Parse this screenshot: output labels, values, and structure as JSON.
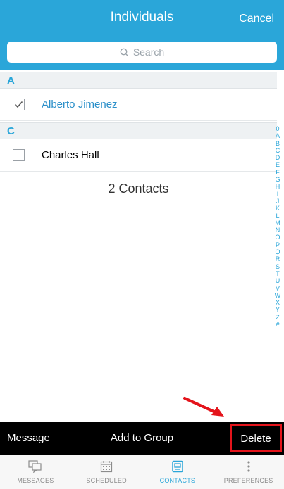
{
  "header": {
    "title": "Individuals",
    "cancel_label": "Cancel"
  },
  "search": {
    "placeholder": "Search"
  },
  "sections": [
    {
      "letter": "A",
      "contacts": [
        {
          "name": "Alberto Jimenez",
          "checked": true
        }
      ]
    },
    {
      "letter": "C",
      "contacts": [
        {
          "name": "Charles Hall",
          "checked": false
        }
      ]
    }
  ],
  "contacts_count": "2 Contacts",
  "index_letters": [
    "0",
    "A",
    "B",
    "C",
    "D",
    "E",
    "F",
    "G",
    "H",
    "I",
    "J",
    "K",
    "L",
    "M",
    "N",
    "O",
    "P",
    "Q",
    "R",
    "S",
    "T",
    "U",
    "V",
    "W",
    "X",
    "Y",
    "Z",
    "#"
  ],
  "action_bar": {
    "message_label": "Message",
    "add_group_label": "Add to Group",
    "delete_label": "Delete"
  },
  "tabbar": {
    "tabs": [
      {
        "label": "MESSAGES",
        "icon": "messages-icon",
        "active": false
      },
      {
        "label": "SCHEDULED",
        "icon": "calendar-icon",
        "active": false
      },
      {
        "label": "CONTACTS",
        "icon": "contacts-icon",
        "active": true
      },
      {
        "label": "PREFERENCES",
        "icon": "more-icon",
        "active": false
      }
    ]
  },
  "colors": {
    "accent": "#2aa6d9",
    "highlight": "#e4141b",
    "action_bar": "#000000"
  }
}
